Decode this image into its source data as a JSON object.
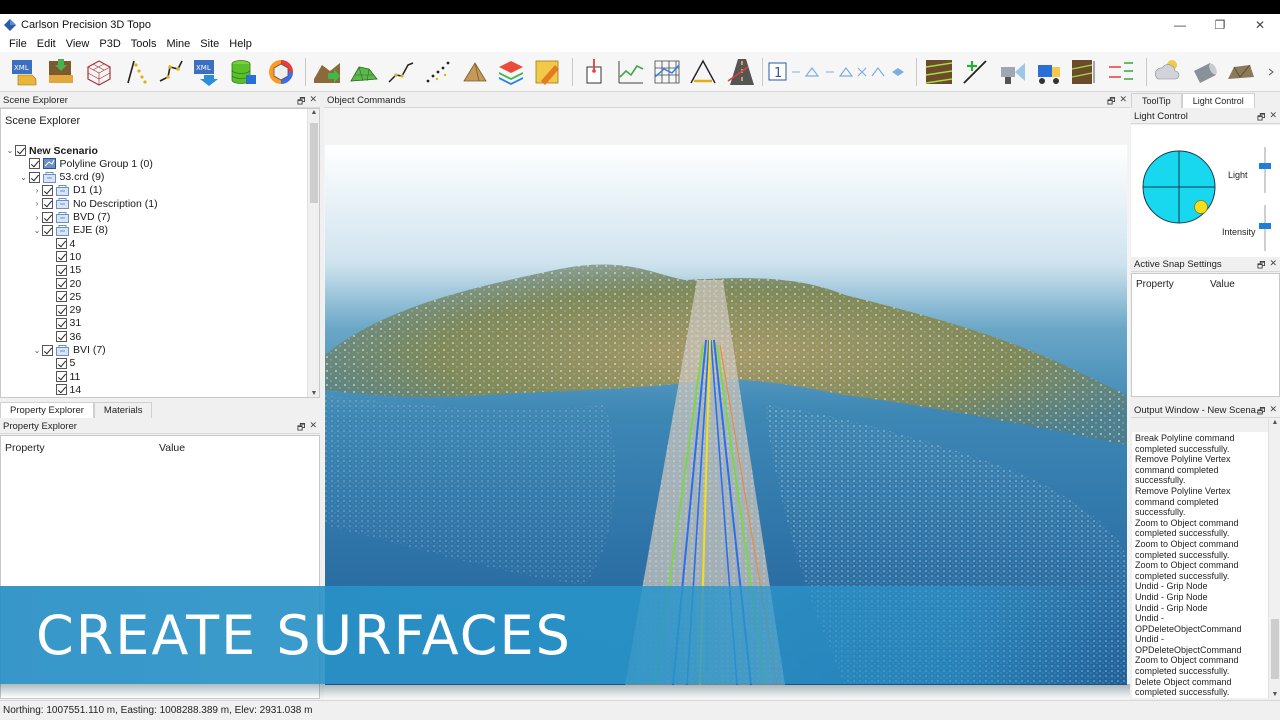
{
  "window": {
    "title": "Carlson Precision 3D Topo",
    "minimize": "—",
    "restore": "❐",
    "close": "✕"
  },
  "menu": [
    "File",
    "Edit",
    "View",
    "P3D",
    "Tools",
    "Mine",
    "Site",
    "Help"
  ],
  "toolbar": {
    "xml_badge": "XML",
    "number_tool": "1"
  },
  "scene_explorer": {
    "panel_title": "Scene Explorer",
    "tree_title": "Scene Explorer",
    "items": [
      {
        "label": "New Scenario",
        "bold": true
      },
      {
        "label": "Polyline Group 1 (0)"
      },
      {
        "label": "53.crd (9)"
      },
      {
        "label": "D1 (1)"
      },
      {
        "label": "No Description (1)"
      },
      {
        "label": "BVD (7)"
      },
      {
        "label": "EJE (8)"
      },
      {
        "label": "4"
      },
      {
        "label": "10"
      },
      {
        "label": "15"
      },
      {
        "label": "20"
      },
      {
        "label": "25"
      },
      {
        "label": "29"
      },
      {
        "label": "31"
      },
      {
        "label": "36"
      },
      {
        "label": "BVI (7)"
      },
      {
        "label": "5"
      },
      {
        "label": "11"
      },
      {
        "label": "14"
      }
    ]
  },
  "bottom_tabs": [
    "Property Explorer",
    "Materials"
  ],
  "property_explorer": {
    "panel_title": "Property Explorer",
    "col_property": "Property",
    "col_value": "Value"
  },
  "object_commands": {
    "panel_title": "Object Commands"
  },
  "right_tabs": [
    "ToolTip",
    "Light Control"
  ],
  "light_control": {
    "panel_title": "Light Control",
    "light_label": "Light",
    "intensity_label": "Intensity",
    "light_level": 0.6,
    "intensity_level": 0.55,
    "colors": {
      "disc": "#17d8ef",
      "sun": "#f2e01c"
    }
  },
  "snap_settings": {
    "panel_title": "Active Snap Settings",
    "col_property": "Property",
    "col_value": "Value"
  },
  "output_window": {
    "panel_title": "Output Window - New Scena...",
    "lines": [
      "Break Polyline command completed successfully.",
      "Remove Polyline Vertex command completed successfully.",
      "Remove Polyline Vertex command completed successfully.",
      "Zoom to Object command completed successfully.",
      "Zoom to Object command completed successfully.",
      "Zoom to Object command completed successfully.",
      "Undid - Grip Node",
      "Undid - Grip Node",
      "Undid - Grip Node",
      "Undid - OPDeleteObjectCommand",
      "Undid - OPDeleteObjectCommand",
      "Zoom to Object command completed successfully.",
      "Delete Object command completed successfully."
    ]
  },
  "banner": {
    "text": "CREATE SURFACES"
  },
  "status": {
    "coords": "Northing: 1007551.110 m, Easting: 1008288.389 m, Elev: 2931.038 m"
  }
}
